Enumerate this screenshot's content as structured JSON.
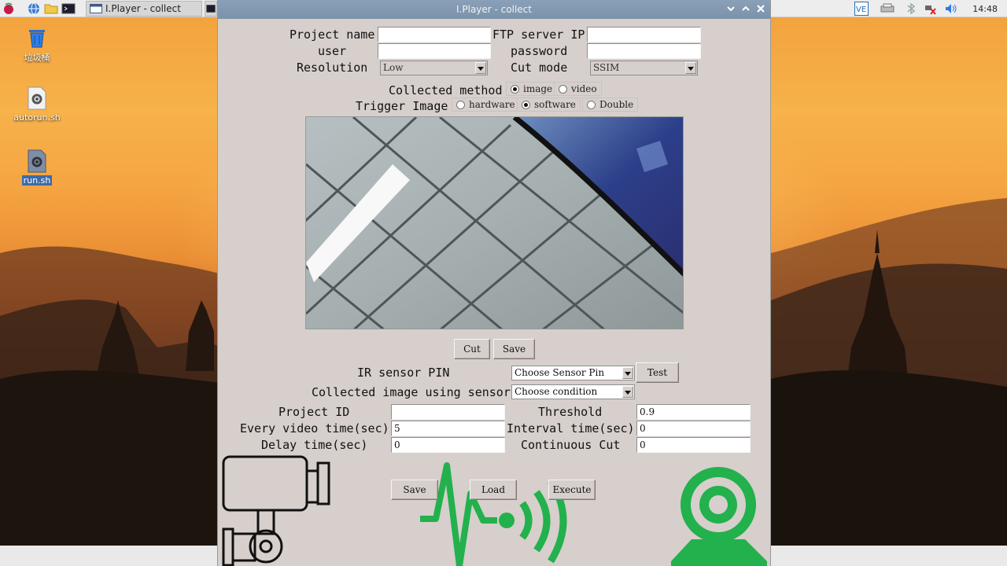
{
  "taskbar": {
    "task_label": "I.Player - collect",
    "clock": "14:48",
    "icons": [
      "raspberry-icon",
      "globe-icon",
      "folder-icon",
      "terminal-icon"
    ]
  },
  "desktop": {
    "icons": [
      {
        "label": "垃圾桶",
        "icon": "trash-icon"
      },
      {
        "label": "autorun.sh",
        "icon": "script-gear-icon"
      },
      {
        "label": "run.sh",
        "icon": "script-gear-icon"
      }
    ]
  },
  "window": {
    "title": "I.Player - collect",
    "form": {
      "project_name_label": "Project name",
      "project_name_value": "",
      "ftp_label": "FTP server IP",
      "ftp_value": "",
      "user_label": "user",
      "user_value": "",
      "password_label": "password",
      "password_value": "",
      "resolution_label": "Resolution",
      "resolution_value": "Low",
      "cut_mode_label": "Cut mode",
      "cut_mode_value": "SSIM",
      "collected_method_label": "Collected method",
      "method_options": [
        {
          "label": "image",
          "selected": true
        },
        {
          "label": "video",
          "selected": false
        }
      ],
      "trigger_label": "Trigger Image",
      "trigger_options": [
        {
          "label": "hardware",
          "selected": false
        },
        {
          "label": "software",
          "selected": true
        },
        {
          "label": "Double",
          "selected": false
        }
      ]
    },
    "preview_buttons": {
      "cut": "Cut",
      "save": "Save"
    },
    "sensor": {
      "ir_label": "IR sensor PIN",
      "ir_value": "Choose Sensor Pin",
      "test_button": "Test",
      "condition_label": "Collected image using sensor",
      "condition_value": "Choose condition"
    },
    "params": {
      "project_id_label": "Project ID",
      "project_id_value": "",
      "threshold_label": "Threshold",
      "threshold_value": "0.9",
      "video_time_label": "Every video time(sec)",
      "video_time_value": "5",
      "interval_label": "Interval time(sec)",
      "interval_value": "0",
      "delay_label": "Delay time(sec)",
      "delay_value": "0",
      "continuous_label": "Continuous Cut",
      "continuous_value": "0"
    },
    "actions": {
      "save": "Save",
      "load": "Load",
      "execute": "Execute"
    },
    "colors": {
      "logo_green": "#22b14c",
      "window_bg": "#d6cfcc",
      "titlebar": "#7f95ad"
    }
  }
}
